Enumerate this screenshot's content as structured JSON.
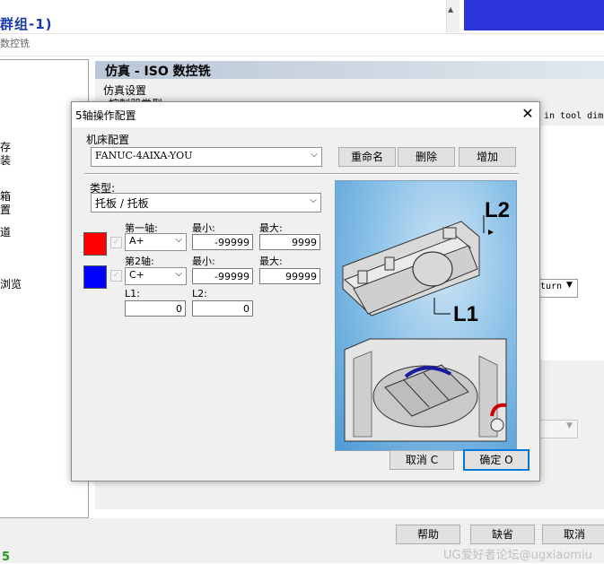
{
  "background": {
    "title": "群组-1)",
    "subtitle": "数控铣",
    "left_items": [
      "存",
      "装",
      "箱",
      "置",
      "道",
      "浏览"
    ],
    "panel_header": "仿真 - ISO 数控铣",
    "sim_settings": "仿真设置",
    "controller_type": "控制器类型",
    "english_hint": "in tool dim",
    "turn_combo": "turn",
    "buttons": {
      "help": "帮助",
      "default": "缺省",
      "cancel": "取消"
    },
    "bottom_five": "5",
    "watermark": "UG爱好者论坛@ugxiaomiu"
  },
  "dialog": {
    "title": "5轴操作配置",
    "close_glyph": "✕",
    "machine_config_label": "机床配置",
    "machine_config_value": "FANUC-4AIXA-YOU",
    "rename_button": "重命名",
    "delete_button": "删除",
    "add_button": "增加",
    "type_label": "类型:",
    "type_value": "托板 / 托板",
    "axis1": {
      "label": "第一轴:",
      "value": "A+",
      "min_label": "最小:",
      "min": "-99999",
      "max_label": "最大:",
      "max": "9999",
      "color": "#ff0000"
    },
    "axis2": {
      "label": "第2轴:",
      "value": "C+",
      "min_label": "最小:",
      "min": "-99999",
      "max_label": "最大:",
      "max": "99999",
      "color": "#0000ff"
    },
    "l1_label": "L1:",
    "l1_value": "0",
    "l2_label": "L2:",
    "l2_value": "0",
    "preview_labels": {
      "l2": "L2",
      "l1": "L1"
    },
    "cancel_button": "取消 C",
    "ok_button": "确定 O"
  }
}
